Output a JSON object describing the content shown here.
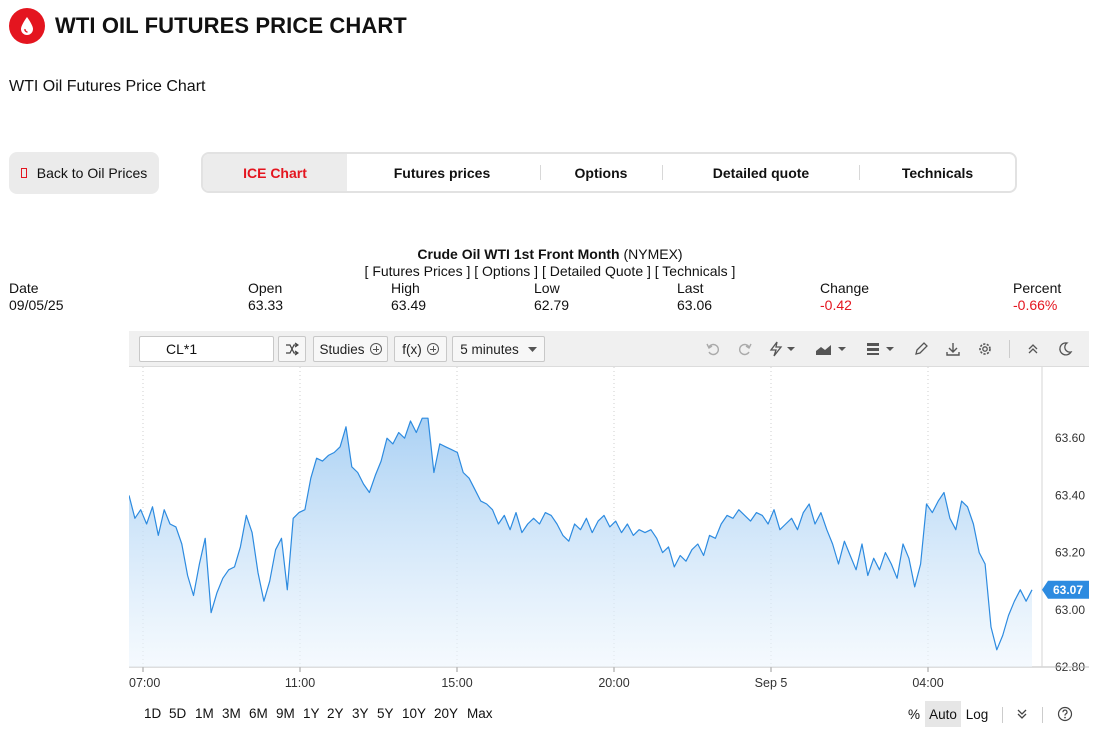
{
  "header": {
    "title": "WTI OIL FUTURES PRICE CHART",
    "subtitle": "WTI Oil Futures Price Chart",
    "brand_color": "#e4151f"
  },
  "nav": {
    "back_label": "Back to Oil Prices",
    "tabs": [
      {
        "label": "ICE Chart",
        "active": true
      },
      {
        "label": "Futures prices",
        "active": false
      },
      {
        "label": "Options",
        "active": false
      },
      {
        "label": "Detailed quote",
        "active": false
      },
      {
        "label": "Technicals",
        "active": false
      }
    ]
  },
  "quote": {
    "title_bold": "Crude Oil WTI 1st Front Month",
    "title_exchange": "(NYMEX)",
    "links": "[ Futures Prices ] [ Options ] [ Detailed Quote ] [ Technicals ]",
    "columns": [
      {
        "label": "Date",
        "value": "09/05/25",
        "negative": false
      },
      {
        "label": "Open",
        "value": "63.33",
        "negative": false
      },
      {
        "label": "High",
        "value": "63.49",
        "negative": false
      },
      {
        "label": "Low",
        "value": "62.79",
        "negative": false
      },
      {
        "label": "Last",
        "value": "63.06",
        "negative": false
      },
      {
        "label": "Change",
        "value": "-0.42",
        "negative": true
      },
      {
        "label": "Percent",
        "value": "-0.66%",
        "negative": true
      }
    ]
  },
  "toolbar": {
    "symbol": "CL*1",
    "studies_label": "Studies",
    "fx_label": "f(x)",
    "interval_label": "5 minutes",
    "icons": [
      "undo-icon",
      "redo-icon",
      "bolt-icon",
      "chart-type-icon",
      "layout-icon",
      "pencil-icon",
      "download-icon",
      "gear-icon",
      "collapse-icon",
      "moon-icon"
    ]
  },
  "bottom": {
    "ranges": [
      "1D",
      "5D",
      "1M",
      "3M",
      "6M",
      "9M",
      "1Y",
      "2Y",
      "3Y",
      "5Y",
      "10Y",
      "20Y",
      "Max"
    ],
    "scales": [
      {
        "label": "%",
        "active": false
      },
      {
        "label": "Auto",
        "active": true
      },
      {
        "label": "Log",
        "active": false
      }
    ]
  },
  "chart_data": {
    "type": "area",
    "x_ticks": [
      "07:00",
      "11:00",
      "15:00",
      "20:00",
      "Sep 5",
      "04:00"
    ],
    "y_ticks": [
      "63.60",
      "63.40",
      "63.20",
      "63.00",
      "62.80"
    ],
    "ylim": [
      62.8,
      63.8
    ],
    "last_price_label": "63.07",
    "line_color": "#2d8be0",
    "grid": true,
    "series": [
      {
        "values": [
          63.4,
          63.32,
          63.35,
          63.3,
          63.36,
          63.26,
          63.35,
          63.3,
          63.29,
          63.23,
          63.12,
          63.05,
          63.16,
          63.25,
          62.99,
          63.06,
          63.11,
          63.14,
          63.15,
          63.22,
          63.33,
          63.27,
          63.13,
          63.03,
          63.1,
          63.21,
          63.25,
          63.07,
          63.32,
          63.34,
          63.35,
          63.46,
          63.53,
          63.52,
          63.54,
          63.55,
          63.57,
          63.64,
          63.5,
          63.48,
          63.44,
          63.41,
          63.47,
          63.52,
          63.6,
          63.58,
          63.62,
          63.6,
          63.66,
          63.62,
          63.67,
          63.67,
          63.48,
          63.58,
          63.57,
          63.56,
          63.55,
          63.48,
          63.46,
          63.42,
          63.38,
          63.37,
          63.35,
          63.3,
          63.33,
          63.28,
          63.34,
          63.27,
          63.3,
          63.32,
          63.3,
          63.34,
          63.33,
          63.3,
          63.26,
          63.24,
          63.3,
          63.28,
          63.32,
          63.27,
          63.31,
          63.33,
          63.29,
          63.31,
          63.27,
          63.3,
          63.26,
          63.28,
          63.27,
          63.28,
          63.25,
          63.2,
          63.22,
          63.15,
          63.19,
          63.17,
          63.21,
          63.23,
          63.19,
          63.26,
          63.25,
          63.3,
          63.33,
          63.32,
          63.35,
          63.33,
          63.31,
          63.34,
          63.33,
          63.3,
          63.35,
          63.28,
          63.3,
          63.32,
          63.28,
          63.34,
          63.37,
          63.3,
          63.34,
          63.28,
          63.23,
          63.16,
          63.24,
          63.19,
          63.14,
          63.23,
          63.12,
          63.18,
          63.14,
          63.2,
          63.16,
          63.11,
          63.23,
          63.18,
          63.08,
          63.16,
          63.37,
          63.34,
          63.38,
          63.41,
          63.32,
          63.28,
          63.38,
          63.36,
          63.3,
          63.2,
          63.16,
          62.94,
          62.86,
          62.91,
          62.98,
          63.03,
          63.07,
          63.03,
          63.07
        ]
      }
    ]
  }
}
